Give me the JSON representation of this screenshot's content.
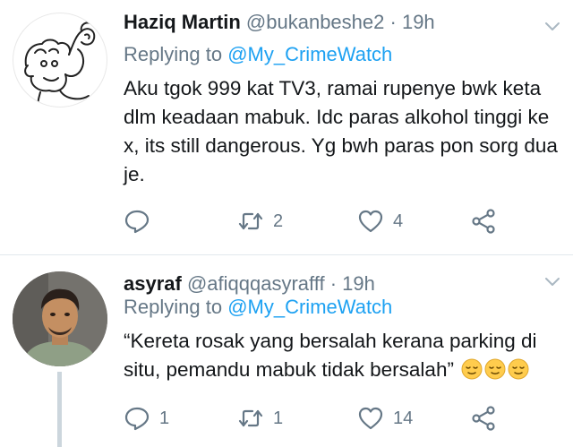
{
  "tweets": [
    {
      "name": "Haziq Martin",
      "handle": "@bukanbeshe2",
      "separator": "·",
      "time": "19h",
      "replying_prefix": "Replying to",
      "replying_to": "@My_CrimeWatch",
      "text": "Aku tgok 999 kat TV3, ramai rupenye bwk keta dlm keadaan mabuk. Idc paras alkohol tinggi ke x, its still dangerous. Yg bwh paras pon sorg dua je.",
      "reply_count": "",
      "retweet_count": "2",
      "like_count": "4"
    },
    {
      "name": "asyraf",
      "handle": "@afiqqqasyrafff",
      "separator": "·",
      "time": "19h",
      "replying_prefix": "Replying to",
      "replying_to": "@My_CrimeWatch",
      "text": "“Kereta rosak yang bersalah kerana parking di situ, pemandu mabuk tidak bersalah”",
      "emojis": [
        "relieved-face-icon",
        "relieved-face-icon",
        "relieved-face-icon"
      ],
      "reply_count": "1",
      "retweet_count": "1",
      "like_count": "14"
    }
  ],
  "colors": {
    "link": "#1da1f2",
    "secondary": "#657786",
    "text": "#14171a",
    "divider": "#e1e8ed",
    "thread": "#ccd6dd"
  }
}
